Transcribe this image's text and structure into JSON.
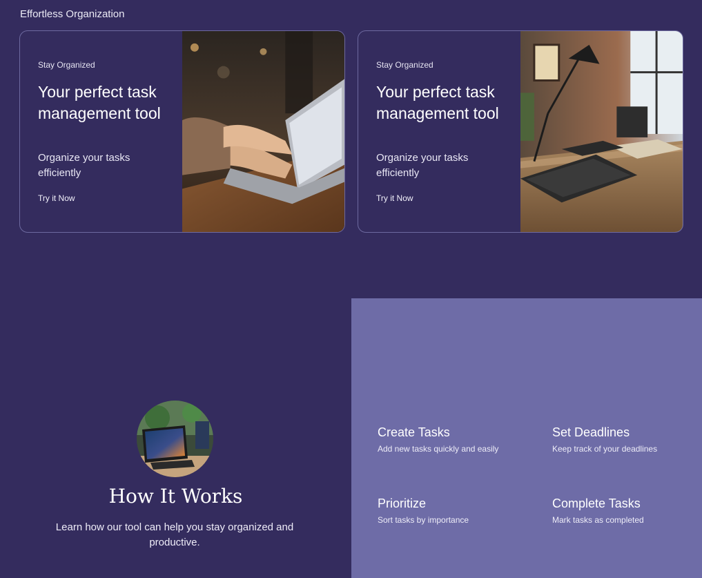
{
  "section_label": "Effortless Organization",
  "cards": [
    {
      "eyebrow": "Stay Organized",
      "title": "Your perfect task management tool",
      "subtitle": "Organize your tasks efficiently",
      "cta": "Try it Now",
      "image": "laptop-typing-photo"
    },
    {
      "eyebrow": "Stay Organized",
      "title": "Your perfect task management tool",
      "subtitle": "Organize your tasks efficiently",
      "cta": "Try it Now",
      "image": "desk-lamp-photo"
    }
  ],
  "how": {
    "title": "How It Works",
    "description": "Learn how our tool can help you stay organized and productive.",
    "image": "tablet-on-desk-photo"
  },
  "features": [
    {
      "title": "Create Tasks",
      "description": "Add new tasks quickly and easily"
    },
    {
      "title": "Set Deadlines",
      "description": "Keep track of your deadlines"
    },
    {
      "title": "Prioritize",
      "description": "Sort tasks by importance"
    },
    {
      "title": "Complete Tasks",
      "description": "Mark tasks as completed"
    }
  ],
  "colors": {
    "background": "#342c5e",
    "features_panel": "#6e6ca7",
    "card_border": "#6e6aa0"
  }
}
